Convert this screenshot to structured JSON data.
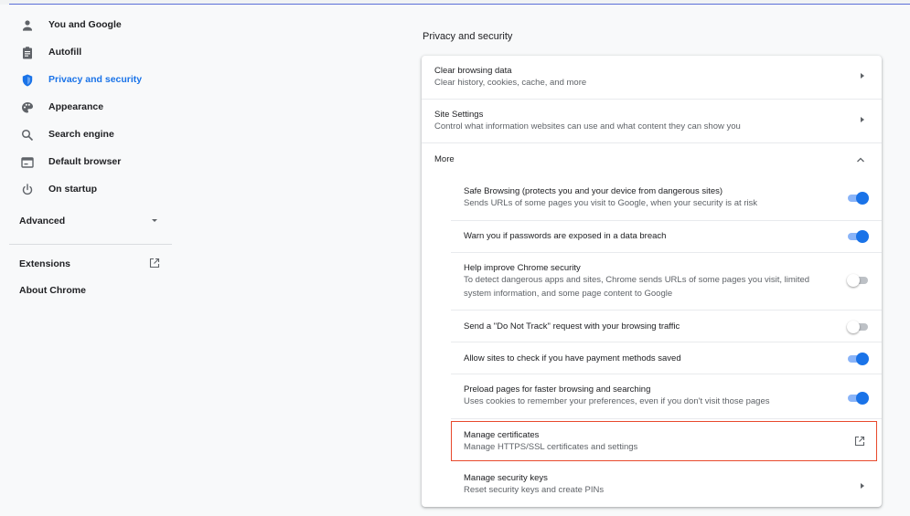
{
  "sidebar": {
    "items": [
      {
        "label": "You and Google",
        "icon": "person-icon"
      },
      {
        "label": "Autofill",
        "icon": "clipboard-icon"
      },
      {
        "label": "Privacy and security",
        "icon": "shield-icon"
      },
      {
        "label": "Appearance",
        "icon": "palette-icon"
      },
      {
        "label": "Search engine",
        "icon": "search-icon"
      },
      {
        "label": "Default browser",
        "icon": "browser-icon"
      },
      {
        "label": "On startup",
        "icon": "power-icon"
      }
    ],
    "active": "Privacy and security",
    "advanced": "Advanced",
    "extensions": "Extensions",
    "about": "About Chrome"
  },
  "content": {
    "section_title": "Privacy and security",
    "clear_browsing": {
      "title": "Clear browsing data",
      "subtitle": "Clear history, cookies, cache, and more"
    },
    "site_settings": {
      "title": "Site Settings",
      "subtitle": "Control what information websites can use and what content they can show you"
    },
    "more": "More",
    "safe_browsing": {
      "title": "Safe Browsing (protects you and your device from dangerous sites)",
      "subtitle": "Sends URLs of some pages you visit to Google, when your security is at risk",
      "enabled": true
    },
    "password_breach": {
      "title": "Warn you if passwords are exposed in a data breach",
      "enabled": true
    },
    "help_improve": {
      "title": "Help improve Chrome security",
      "subtitle_line1": "To detect dangerous apps and sites, Chrome sends URLs of some pages you visit, limited",
      "subtitle_line2": "system information, and some page content to Google",
      "enabled": false
    },
    "do_not_track": {
      "title": "Send a \"Do Not Track\" request with your browsing traffic",
      "enabled": false
    },
    "payment_methods": {
      "title": "Allow sites to check if you have payment methods saved",
      "enabled": true
    },
    "preload": {
      "title": "Preload pages for faster browsing and searching",
      "subtitle": "Uses cookies to remember your preferences, even if you don't visit those pages",
      "enabled": true
    },
    "manage_certs": {
      "title": "Manage certificates",
      "subtitle": "Manage HTTPS/SSL certificates and settings"
    },
    "security_keys": {
      "title": "Manage security keys",
      "subtitle": "Reset security keys and create PINs"
    }
  },
  "colors": {
    "accent": "#1a73e8",
    "highlight_border": "#e8492c"
  }
}
